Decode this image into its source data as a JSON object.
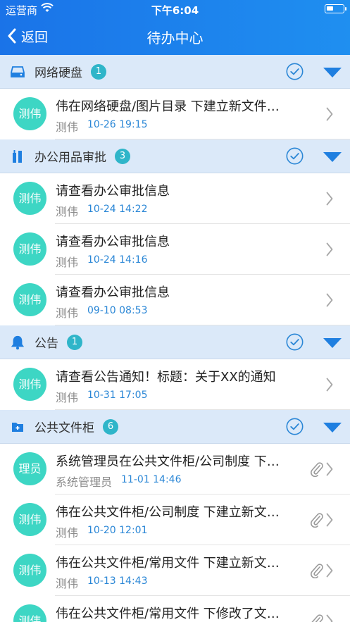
{
  "status_bar": {
    "carrier": "运营商",
    "time": "下午6:04"
  },
  "nav": {
    "back_label": "返回",
    "title": "待办中心"
  },
  "colors": {
    "header": "#1a73e8",
    "section_bg": "#dbe9f9",
    "avatar": "#3dd6c4",
    "badge": "#2fb5c9",
    "time_text": "#2b87d6"
  },
  "sections": [
    {
      "title": "网络硬盘",
      "count": "1",
      "icon": "hard-drive-icon",
      "items": [
        {
          "avatar": "测伟",
          "title": "伟在网络硬盘/图片目录 下建立新文件…",
          "sender": "测伟",
          "time": "10-26 19:15"
        }
      ]
    },
    {
      "title": "办公用品审批",
      "count": "3",
      "icon": "office-supplies-icon",
      "items": [
        {
          "avatar": "测伟",
          "title": "请查看办公审批信息",
          "sender": "测伟",
          "time": "10-24 14:22"
        },
        {
          "avatar": "测伟",
          "title": "请查看办公审批信息",
          "sender": "测伟",
          "time": "10-24 14:16"
        },
        {
          "avatar": "测伟",
          "title": "请查看办公审批信息",
          "sender": "测伟",
          "time": "09-10 08:53"
        }
      ]
    },
    {
      "title": "公告",
      "count": "1",
      "icon": "bell-icon",
      "items": [
        {
          "avatar": "测伟",
          "title": "请查看公告通知！标题：关于XX的通知",
          "sender": "测伟",
          "time": "10-31 17:05"
        }
      ]
    },
    {
      "title": "公共文件柜",
      "count": "6",
      "icon": "folder-add-icon",
      "items": [
        {
          "avatar": "理员",
          "title": "系统管理员在公共文件柜/公司制度 下…",
          "sender": "系统管理员",
          "time": "11-01 14:46",
          "attachment": true
        },
        {
          "avatar": "测伟",
          "title": "伟在公共文件柜/公司制度 下建立新文…",
          "sender": "测伟",
          "time": "10-20 12:01",
          "attachment": true
        },
        {
          "avatar": "测伟",
          "title": "伟在公共文件柜/常用文件 下建立新文…",
          "sender": "测伟",
          "time": "10-13 14:43",
          "attachment": true
        },
        {
          "avatar": "测伟",
          "title": "伟在公共文件柜/常用文件 下修改了文…",
          "sender": "",
          "time": "",
          "attachment": true
        }
      ]
    }
  ]
}
